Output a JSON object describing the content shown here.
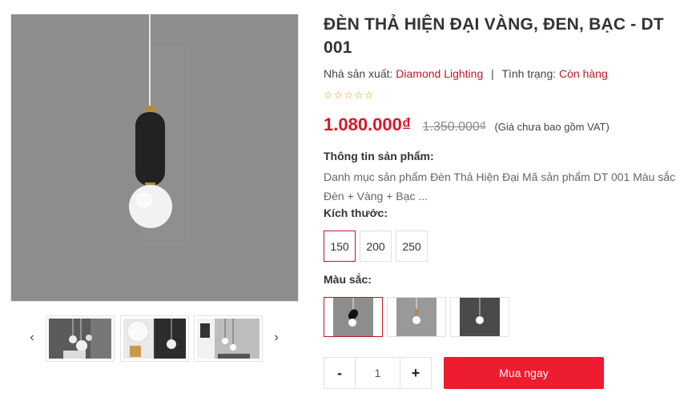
{
  "product": {
    "title": "ĐÈN THẢ HIỆN ĐẠI VÀNG, ĐEN, BẠC - DT 001",
    "manufacturer_label": "Nhà sản xuất:",
    "manufacturer": "Diamond Lighting",
    "separator": "|",
    "status_label": "Tình trạng:",
    "status": "Còn hàng",
    "rating_stars": "☆☆☆☆☆",
    "price": "1.080.000₫",
    "old_price": "1.350.000₫",
    "vat_note": "(Giá chưa bao gồm VAT)",
    "info_label": "Thông tin sản phẩm:",
    "info_text": "Danh mục sản phẩm Đèn Thả Hiện Đại Mã sản phẩm DT 001 Màu sắc Đèn + Vàng + Bạc ..."
  },
  "gallery": {
    "prev_icon": "‹",
    "next_icon": "›",
    "thumbnails": [
      "thumbnail-1",
      "thumbnail-2",
      "thumbnail-3"
    ]
  },
  "options": {
    "size_label": "Kích thước:",
    "sizes": [
      "150",
      "200",
      "250"
    ],
    "selected_size": "150",
    "color_label": "Màu sắc:",
    "colors": [
      "black-gold",
      "silver",
      "dark"
    ],
    "selected_color": "black-gold"
  },
  "purchase": {
    "minus": "-",
    "quantity": "1",
    "plus": "+",
    "buy_label": "Mua ngay"
  },
  "colors": {
    "accent": "#ed1c2e",
    "price": "#d9172a",
    "link": "#c0182b",
    "image_bg": "#8d8d8d"
  }
}
